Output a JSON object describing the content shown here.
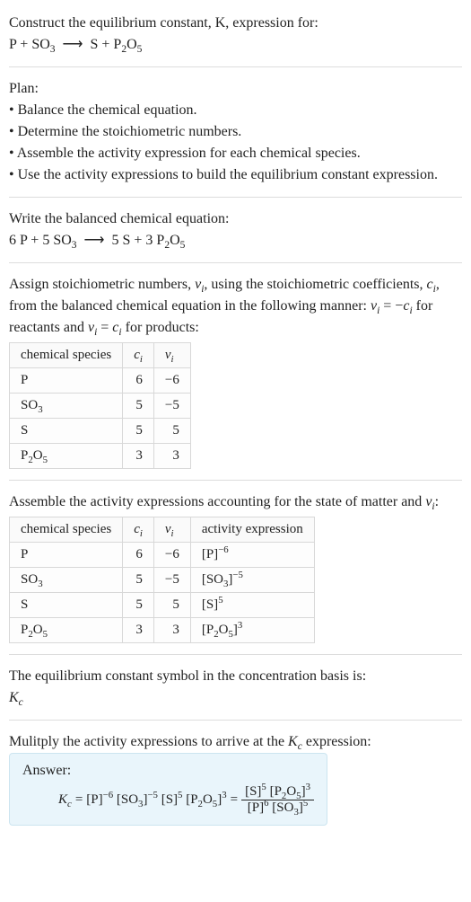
{
  "intro": {
    "title_line": "Construct the equilibrium constant, K, expression for:",
    "reaction_lhs": "P + SO",
    "reaction_lhs_sub": "3",
    "arrow": "⟶",
    "reaction_rhs_a": "S + P",
    "reaction_rhs_sub1": "2",
    "reaction_rhs_mid": "O",
    "reaction_rhs_sub2": "5"
  },
  "plan": {
    "heading": "Plan:",
    "items": [
      "• Balance the chemical equation.",
      "• Determine the stoichiometric numbers.",
      "• Assemble the activity expression for each chemical species.",
      "• Use the activity expressions to build the equilibrium constant expression."
    ]
  },
  "balanced": {
    "heading": "Write the balanced chemical equation:",
    "lhs_a": "6 P + 5 SO",
    "lhs_sub": "3",
    "arrow": "⟶",
    "rhs_a": "5 S + 3 P",
    "rhs_sub1": "2",
    "rhs_mid": "O",
    "rhs_sub2": "5"
  },
  "stoich": {
    "text_a": "Assign stoichiometric numbers, ",
    "nu": "ν",
    "text_b": ", using the stoichiometric coefficients, ",
    "c": "c",
    "text_c": ", from the balanced chemical equation in the following manner: ",
    "rel1_lhs": "ν",
    "rel1_eq": " = −",
    "rel1_rhs": "c",
    "text_d": " for reactants and ",
    "rel2_lhs": "ν",
    "rel2_eq": " = ",
    "rel2_rhs": "c",
    "text_e": " for products:",
    "headers": {
      "species": "chemical species",
      "c": "c",
      "nu": "ν"
    },
    "rows": [
      {
        "species_html": "P",
        "c": "6",
        "nu": "−6"
      },
      {
        "species_html": "SO3",
        "c": "5",
        "nu": "−5"
      },
      {
        "species_html": "S",
        "c": "5",
        "nu": "5"
      },
      {
        "species_html": "P2O5",
        "c": "3",
        "nu": "3"
      }
    ]
  },
  "activity": {
    "text_a": "Assemble the activity expressions accounting for the state of matter and ",
    "nu": "ν",
    "text_b": ":",
    "headers": {
      "species": "chemical species",
      "c": "c",
      "nu": "ν",
      "act": "activity expression"
    },
    "rows": [
      {
        "c": "6",
        "nu": "−6"
      },
      {
        "c": "5",
        "nu": "−5"
      },
      {
        "c": "5",
        "nu": "5"
      },
      {
        "c": "3",
        "nu": "3"
      }
    ]
  },
  "basis": {
    "line1": "The equilibrium constant symbol in the concentration basis is:",
    "symbol": "K",
    "sub": "c"
  },
  "multiply": {
    "line": "Mulitply the activity expressions to arrive at the ",
    "k": "K",
    "ksub": "c",
    "line_end": " expression:"
  },
  "answer": {
    "label": "Answer:",
    "k": "K",
    "ksub": "c",
    "eq": " = "
  }
}
